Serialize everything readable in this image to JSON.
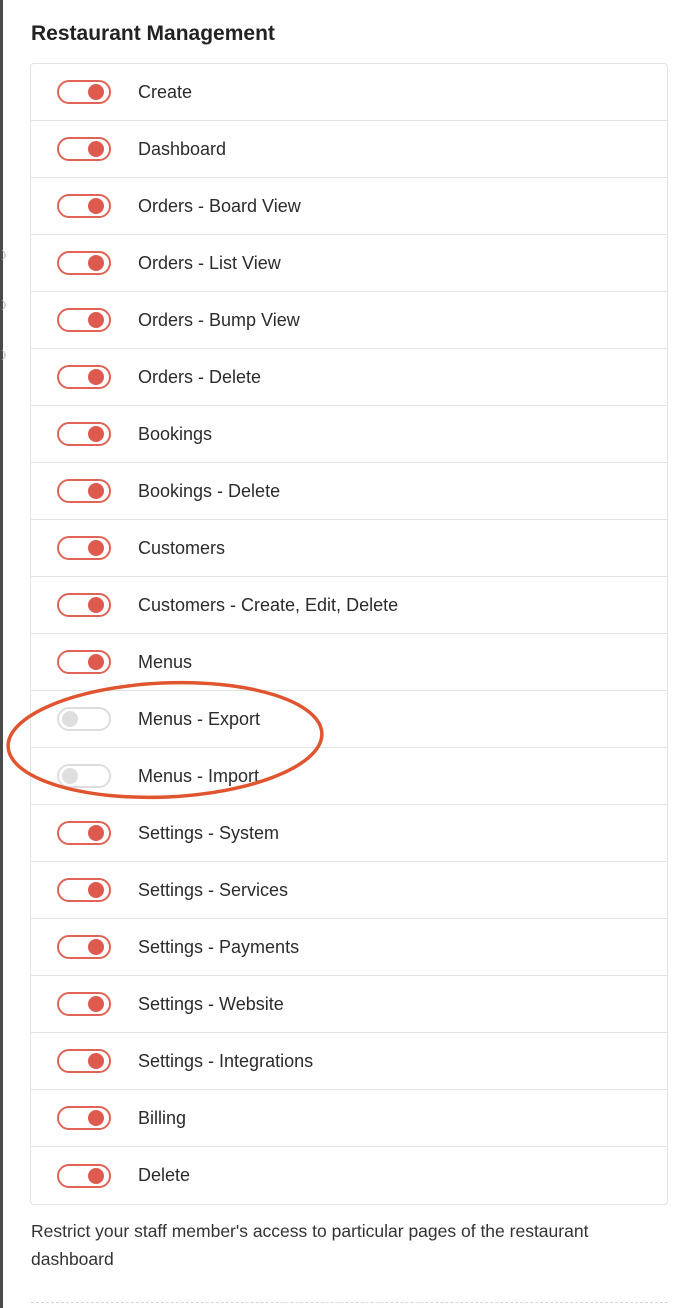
{
  "section": {
    "title": "Restaurant Management"
  },
  "permissions": [
    {
      "label": "Create",
      "enabled": true
    },
    {
      "label": "Dashboard",
      "enabled": true
    },
    {
      "label": "Orders - Board View",
      "enabled": true
    },
    {
      "label": "Orders - List View",
      "enabled": true
    },
    {
      "label": "Orders - Bump View",
      "enabled": true
    },
    {
      "label": "Orders - Delete",
      "enabled": true
    },
    {
      "label": "Bookings",
      "enabled": true
    },
    {
      "label": "Bookings - Delete",
      "enabled": true
    },
    {
      "label": "Customers",
      "enabled": true
    },
    {
      "label": "Customers - Create, Edit, Delete",
      "enabled": true
    },
    {
      "label": "Menus",
      "enabled": true
    },
    {
      "label": "Menus - Export",
      "enabled": false
    },
    {
      "label": "Menus - Import",
      "enabled": false
    },
    {
      "label": "Settings - System",
      "enabled": true
    },
    {
      "label": "Settings - Services",
      "enabled": true
    },
    {
      "label": "Settings - Payments",
      "enabled": true
    },
    {
      "label": "Settings - Website",
      "enabled": true
    },
    {
      "label": "Settings - Integrations",
      "enabled": true
    },
    {
      "label": "Billing",
      "enabled": true
    },
    {
      "label": "Delete",
      "enabled": true
    }
  ],
  "help": {
    "text": "Restrict your staff member's access to particular pages of the restaurant dashboard"
  },
  "colors": {
    "toggle_on": "#de5a4f",
    "toggle_off": "#dedede",
    "annotation_circle": "#e0542f"
  }
}
